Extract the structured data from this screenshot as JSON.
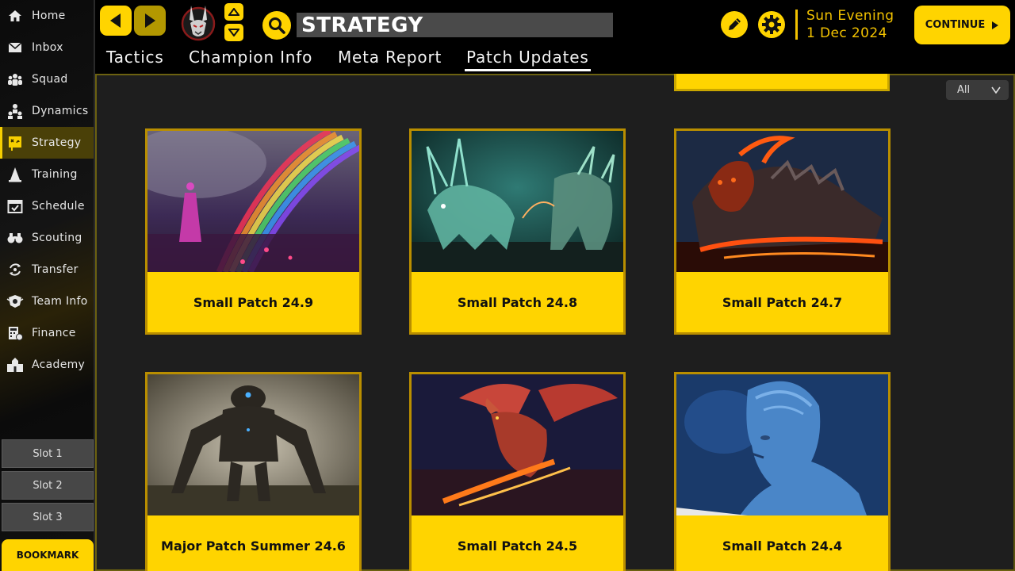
{
  "sidebar": {
    "items": [
      {
        "label": "Home",
        "icon": "home-icon"
      },
      {
        "label": "Inbox",
        "icon": "mail-icon"
      },
      {
        "label": "Squad",
        "icon": "group-icon"
      },
      {
        "label": "Dynamics",
        "icon": "dynamics-icon"
      },
      {
        "label": "Strategy",
        "icon": "strategy-board-icon",
        "active": true
      },
      {
        "label": "Training",
        "icon": "training-cone-icon"
      },
      {
        "label": "Schedule",
        "icon": "calendar-icon"
      },
      {
        "label": "Scouting",
        "icon": "binoculars-icon"
      },
      {
        "label": "Transfer",
        "icon": "transfer-icon"
      },
      {
        "label": "Team Info",
        "icon": "team-crest-icon"
      },
      {
        "label": "Finance",
        "icon": "finance-icon"
      },
      {
        "label": "Academy",
        "icon": "academy-icon"
      }
    ],
    "slots": [
      "Slot 1",
      "Slot 2",
      "Slot 3"
    ],
    "bookmark": "BOOKMARK"
  },
  "header": {
    "search_text": "STRATEGY",
    "date_line1": "Sun  Evening",
    "date_line2": "1 Dec 2024",
    "continue_label": "CONTINUE"
  },
  "tabs": [
    {
      "label": "Tactics"
    },
    {
      "label": "Champion Info"
    },
    {
      "label": "Meta Report"
    },
    {
      "label": "Patch Updates",
      "active": true
    }
  ],
  "filter": {
    "selected": "All",
    "icon": "chevron-down-icon"
  },
  "cards": [
    {
      "title": "Small Patch 24.9",
      "art": "rainbow-girl"
    },
    {
      "title": "Small Patch 24.8",
      "art": "spirit-beasts"
    },
    {
      "title": "Small Patch 24.7",
      "art": "lava-beast"
    },
    {
      "title": "Major Patch Summer 24.6",
      "art": "mech-giant"
    },
    {
      "title": "Small Patch 24.5",
      "art": "fire-dragon"
    },
    {
      "title": "Small Patch 24.4",
      "art": "stone-man"
    }
  ],
  "colors": {
    "accent": "#ffd400",
    "card_border": "#b98e00",
    "date_text": "#f2c200",
    "panel_bg": "#1e1e1e"
  }
}
